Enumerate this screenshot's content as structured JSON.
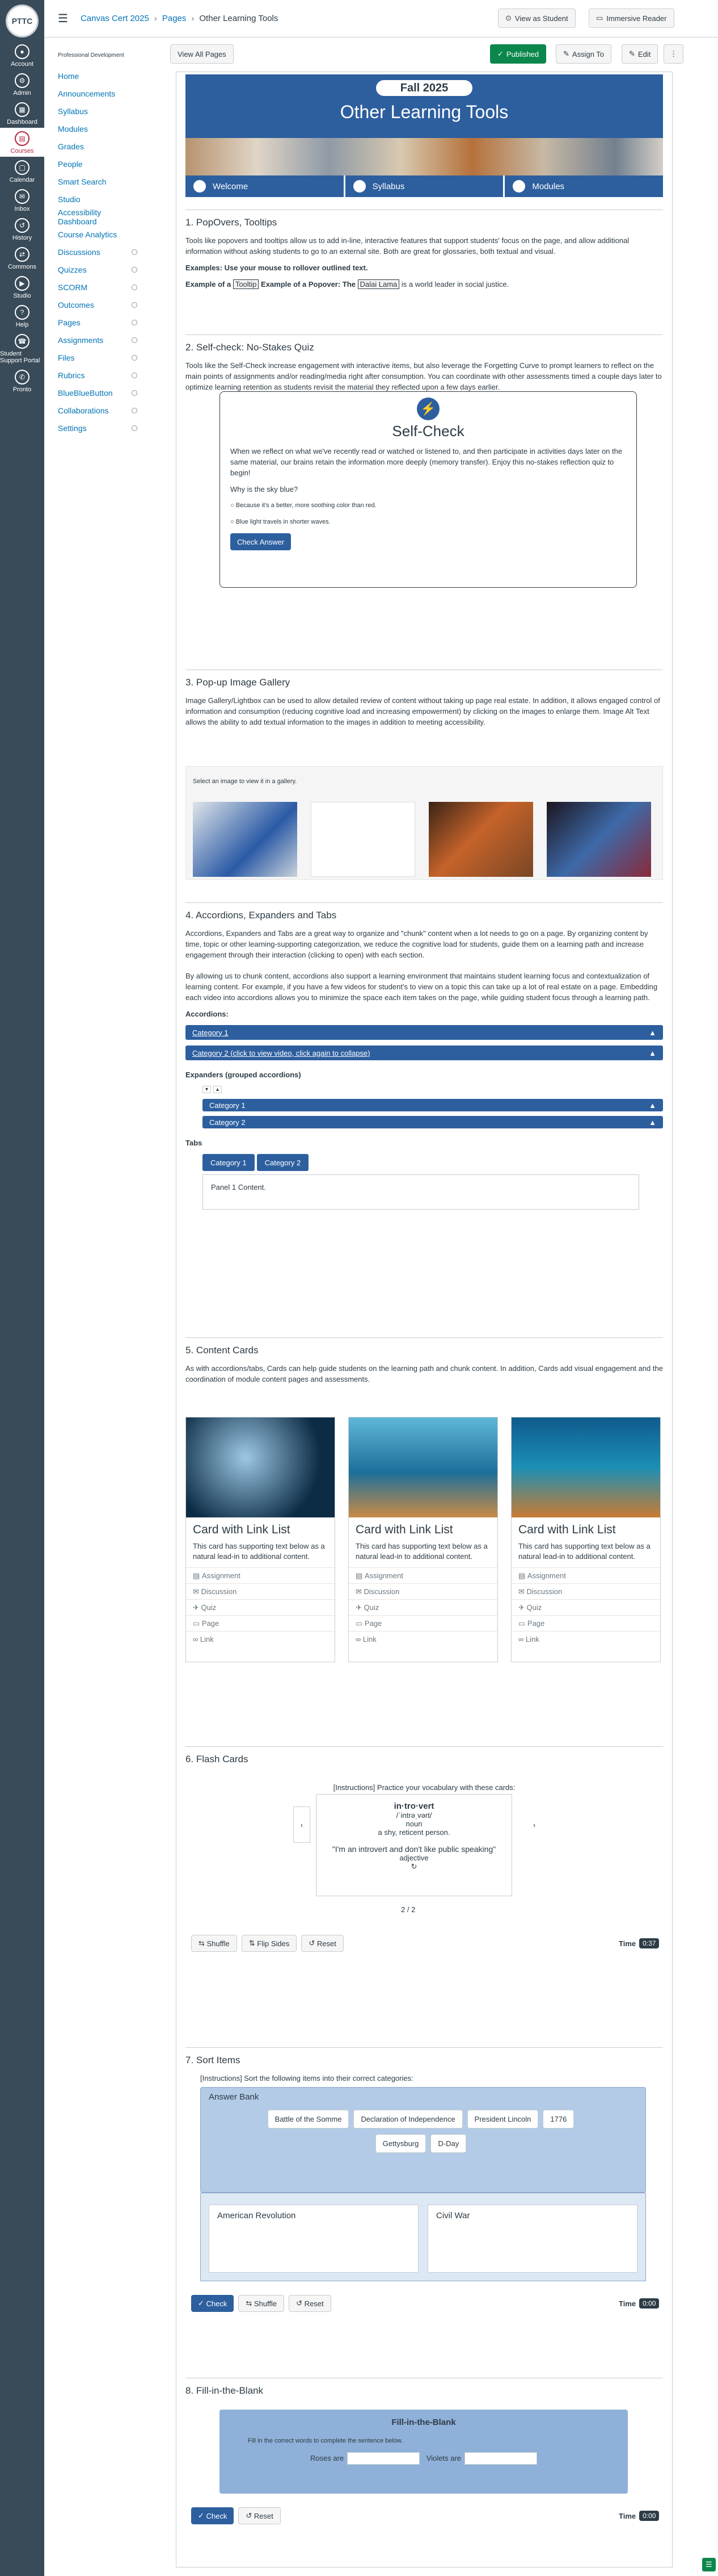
{
  "global_nav": {
    "logo": "PTTC",
    "items": [
      {
        "label": "Account",
        "icon": "●"
      },
      {
        "label": "Admin",
        "icon": "⚙"
      },
      {
        "label": "Dashboard",
        "icon": "▦"
      },
      {
        "label": "Courses",
        "icon": "▤"
      },
      {
        "label": "Calendar",
        "icon": "▢"
      },
      {
        "label": "Inbox",
        "icon": "✉"
      },
      {
        "label": "History",
        "icon": "↺"
      },
      {
        "label": "Commons",
        "icon": "⇄"
      },
      {
        "label": "Studio",
        "icon": "▶"
      },
      {
        "label": "Help",
        "icon": "?"
      },
      {
        "label": "Student Support Portal",
        "icon": "☎"
      },
      {
        "label": "Pronto",
        "icon": "✆"
      }
    ]
  },
  "header": {
    "breadcrumb": [
      "Canvas Cert 2025",
      "Pages",
      "Other Learning Tools"
    ],
    "view_as_student": "View as Student",
    "immersive_reader": "Immersive Reader"
  },
  "course_nav": {
    "subtitle": "Professional Development",
    "items": [
      "Home",
      "Announcements",
      "Syllabus",
      "Modules",
      "Grades",
      "People",
      "Smart Search",
      "Studio",
      "Accessibility Dashboard",
      "Course Analytics",
      "Discussions",
      "Quizzes",
      "SCORM",
      "Outcomes",
      "Pages",
      "Assignments",
      "Files",
      "Rubrics",
      "BlueBlueButton",
      "Collaborations",
      "Settings"
    ]
  },
  "page_actions": {
    "view_all": "View All Pages",
    "published": "Published",
    "assign_to": "Assign To",
    "edit": "Edit"
  },
  "banner": {
    "term": "Fall 2025",
    "title": "Other Learning Tools",
    "tabs": [
      "Welcome",
      "Syllabus",
      "Modules"
    ]
  },
  "s1": {
    "title": "1. PopOvers, Tooltips",
    "p1": "Tools like popovers and tooltips allow us to add in-line, interactive features that support students' focus on the page, and allow additional information without asking students to go to an external site. Both are great for glossaries, both textual and visual.",
    "examples": "Examples: Use your mouse to rollover outlined text.",
    "ex_tip_pre": "Example of a",
    "ex_tip": "Tooltip",
    "ex_pop_pre": "Example of a Popover: The",
    "ex_pop": "Dalai Lama",
    "ex_pop_post": "is a world leader in social justice."
  },
  "s2": {
    "title": "2. Self-check: No-Stakes Quiz",
    "p1": "Tools like the Self-Check increase engagement with interactive items, but also leverage the Forgetting Curve to prompt learners to reflect on the main points of assignments and/or reading/media right after consumption. You can coordinate with other assessments timed a couple days later to optimize learning retention as students revisit the material they reflected upon a few days earlier.",
    "box_title": "Self-Check",
    "box_p": "When we reflect on what we've recently read or watched or listened to, and then participate in activities days later on the same material, our brains retain the information more deeply (memory transfer). Enjoy this no-stakes reflection quiz to begin!",
    "question": "Why is the sky blue?",
    "opt1": "Because it's a better, more soothing color than red.",
    "opt2": "Blue light travels in shorter waves.",
    "check": "Check Answer"
  },
  "s3": {
    "title": "3. Pop-up Image Gallery",
    "p1": "Image Gallery/Lightbox can be used to allow detailed review of content without taking up page real estate. In addition, it allows engaged control of information and consumption (reducing cognitive load and increasing empowerment) by clicking on the images to enlarge them. Image Alt Text allows the ability to add textual information to the images in addition to meeting accessibility.",
    "gallery_label": "Select an image to view it in a gallery."
  },
  "s4": {
    "title": "4. Accordions, Expanders and Tabs",
    "p1": "Accordions, Expanders and Tabs are a great way to organize and \"chunk\" content when a lot needs to go on a page. By organizing content by time, topic or other learning-supporting categorization, we reduce the cognitive load for students, guide them on a learning path and increase engagement through their interaction (clicking to open) with each section.",
    "p2": "By allowing us to chunk content, accordions also support a learning environment that maintains student learning focus and contextualization of learning content. For example, if you have a few videos for student's to view on a topic this can take up a lot of real estate on a page. Embedding each video into accordions allows you to minimize the space each item takes on the page, while guiding student focus through a learning path.",
    "acc_label": "Accordions:",
    "acc1": "Category 1",
    "acc2": "Category 2 (click to view video, click again to collapse)",
    "exp_label": "Expanders (grouped accordions)",
    "exp1": "Category 1",
    "exp2": "Category 2",
    "tabs_label": "Tabs",
    "tab1": "Category 1",
    "tab2": "Category 2",
    "panel": "Panel 1 Content."
  },
  "s5": {
    "title": "5. Content Cards",
    "p1": "As with accordions/tabs, Cards can help guide students on the learning path and chunk content. In addition, Cards add visual engagement and the coordination of module content pages and assessments.",
    "card_title": "Card with Link List",
    "card_text": "This card has supporting text below as a natural lead-in to additional content.",
    "links": [
      "Assignment",
      "Discussion",
      "Quiz",
      "Page",
      "Link"
    ]
  },
  "s6": {
    "title": "6. Flash Cards",
    "instr": "[Instructions] Practice your vocabulary with these cards:",
    "word": "in·tro·vert",
    "pron": "/ˈintrəˌvərt/",
    "pos": "noun",
    "def": "a shy, reticent person.",
    "quote": "\"I'm an introvert and don't like public speaking\"",
    "pos2": "adjective",
    "count": "2 / 2",
    "shuffle": "Shuffle",
    "flip": "Flip Sides",
    "reset": "Reset",
    "time_label": "Time",
    "time": "0:37"
  },
  "s7": {
    "title": "7. Sort Items",
    "instr": "[Instructions] Sort the following items into their correct categories:",
    "bank": "Answer Bank",
    "items": [
      "Battle of the Somme",
      "Declaration of Independence",
      "President Lincoln",
      "1776",
      "Gettysburg",
      "D-Day"
    ],
    "cat1": "American Revolution",
    "cat2": "Civil War",
    "check": "Check",
    "shuffle": "Shuffle",
    "reset": "Reset",
    "time_label": "Time",
    "time": "0:00"
  },
  "s8": {
    "title": "8. Fill-in-the-Blank",
    "box_title": "Fill-in-the-Blank",
    "instr": "Fill in the correct words to complete the sentence below.",
    "l1": "Roses are",
    "l2": "Violets are",
    "check": "Check",
    "reset": "Reset",
    "time_label": "Time",
    "time": "0:00"
  }
}
